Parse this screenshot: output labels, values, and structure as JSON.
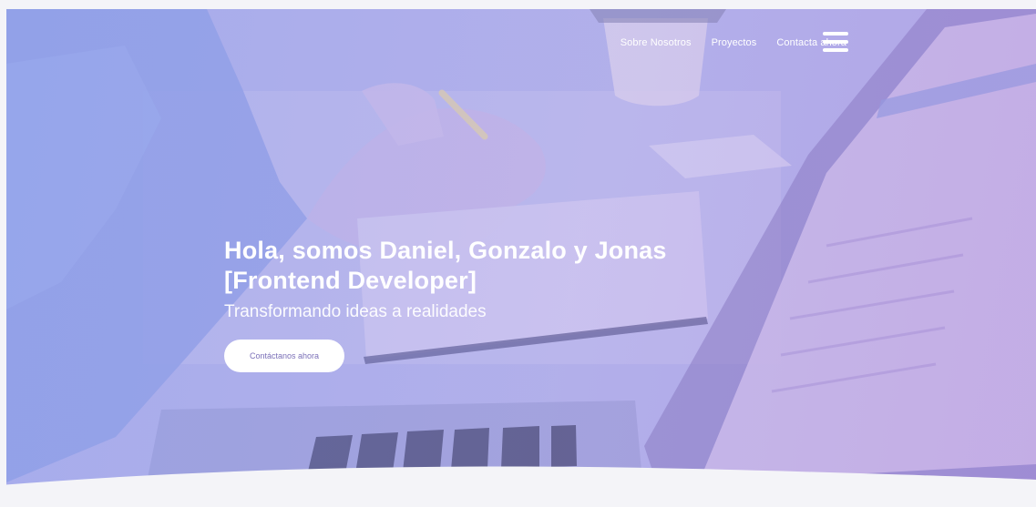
{
  "nav": {
    "links": [
      {
        "label": "Sobre Nosotros"
      },
      {
        "label": "Proyectos"
      },
      {
        "label": "Contacta ahora"
      }
    ],
    "menu_icon": "hamburger-menu-icon"
  },
  "hero": {
    "headline_line1": "Hola, somos Daniel, Gonzalo y Jonas",
    "headline_line2": "[Frontend Developer]",
    "subtitle": "Transformando ideas a realidades",
    "cta_label": "Contáctanos ahora",
    "background_image": "person writing at desk with laptop",
    "colors": {
      "overlay_start": "#a9b6ee",
      "overlay_end": "#b69ae0",
      "cta_text": "#7b70b8",
      "page_background": "#f4f4f8"
    }
  }
}
